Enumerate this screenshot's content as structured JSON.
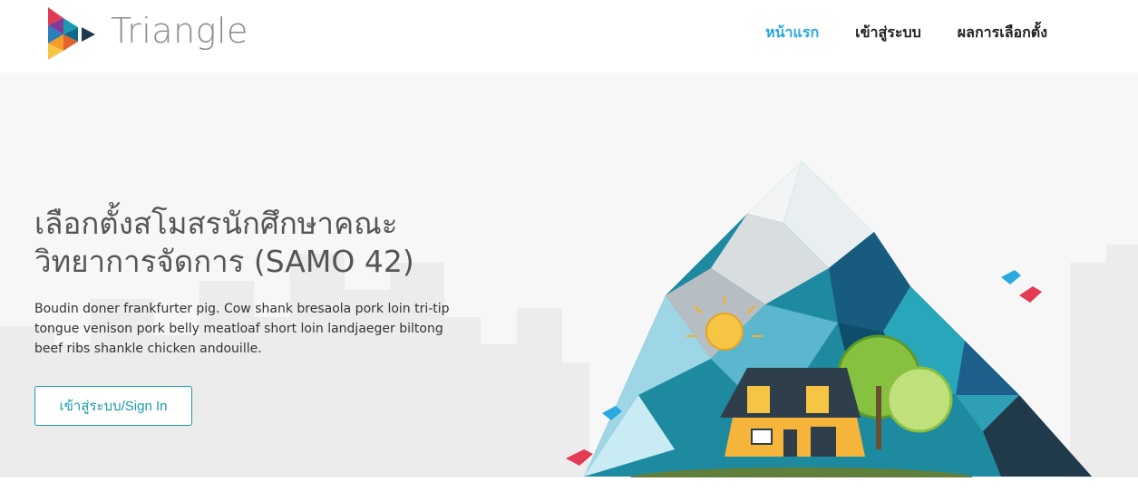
{
  "header": {
    "brand": "Triangle",
    "nav": [
      {
        "label": "หน้าแรก",
        "active": true
      },
      {
        "label": "เข้าสู่ระบบ",
        "active": false
      },
      {
        "label": "ผลการเลือกตั้ง",
        "active": false
      }
    ]
  },
  "hero": {
    "title_line1": "เลือกตั้งสโมสรนักศึกษาคณะ",
    "title_line2": "วิทยาการจัดการ (SAMO 42)",
    "description": "Boudin doner frankfurter pig. Cow shank bresaola pork loin tri-tip tongue venison pork belly meatloaf short loin landjaeger biltong beef ribs shankle chicken andouille.",
    "button_label": "เข้าสู่ระบบ/Sign In"
  },
  "colors": {
    "accent": "#29a9e0",
    "button": "#1a9bb0",
    "mountain_dark": "#1d5f8a",
    "mountain_teal": "#1e8aa0"
  }
}
